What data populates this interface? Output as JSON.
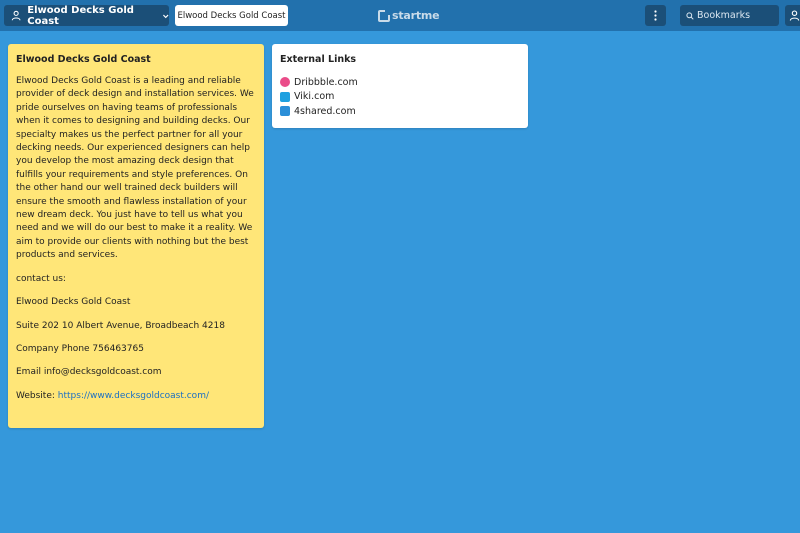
{
  "topbar": {
    "page_name": "Elwood Decks Gold Coast",
    "current_tab": "Elwood Decks Gold Coast",
    "brand": "startme",
    "search_placeholder": "Bookmarks"
  },
  "note": {
    "title": "Elwood Decks Gold Coast",
    "paragraphs": [
      "Elwood Decks Gold Coast is a leading and reliable provider of deck design and installation services. We pride ourselves on having teams of professionals when it comes to designing and building decks. Our specialty makes us the perfect partner for all your decking needs. Our experienced designers can help you develop the most amazing deck design that fulfills your requirements and style preferences. On the other hand our well trained deck builders will ensure the smooth and flawless installation of your new dream deck. You just have to tell us what you need and we will do our best to make it a reality. We aim to provide our clients with nothing but the best products and services.",
      "contact us:",
      "Elwood Decks Gold Coast",
      "Suite 202 10 Albert Avenue, Broadbeach 4218",
      "Company Phone 756463765",
      "Email info@decksgoldcoast.com"
    ],
    "website_label": "Website: ",
    "website_url": "https://www.decksgoldcoast.com/"
  },
  "links": {
    "title": "External Links",
    "items": [
      {
        "label": "Dribbble.com",
        "icon": "dribbble-icon",
        "color": "#ea4c89"
      },
      {
        "label": "Viki.com",
        "icon": "viki-icon",
        "color": "#1ea0e0"
      },
      {
        "label": "4shared.com",
        "icon": "4shared-icon",
        "color": "#2b8fd8"
      }
    ]
  }
}
